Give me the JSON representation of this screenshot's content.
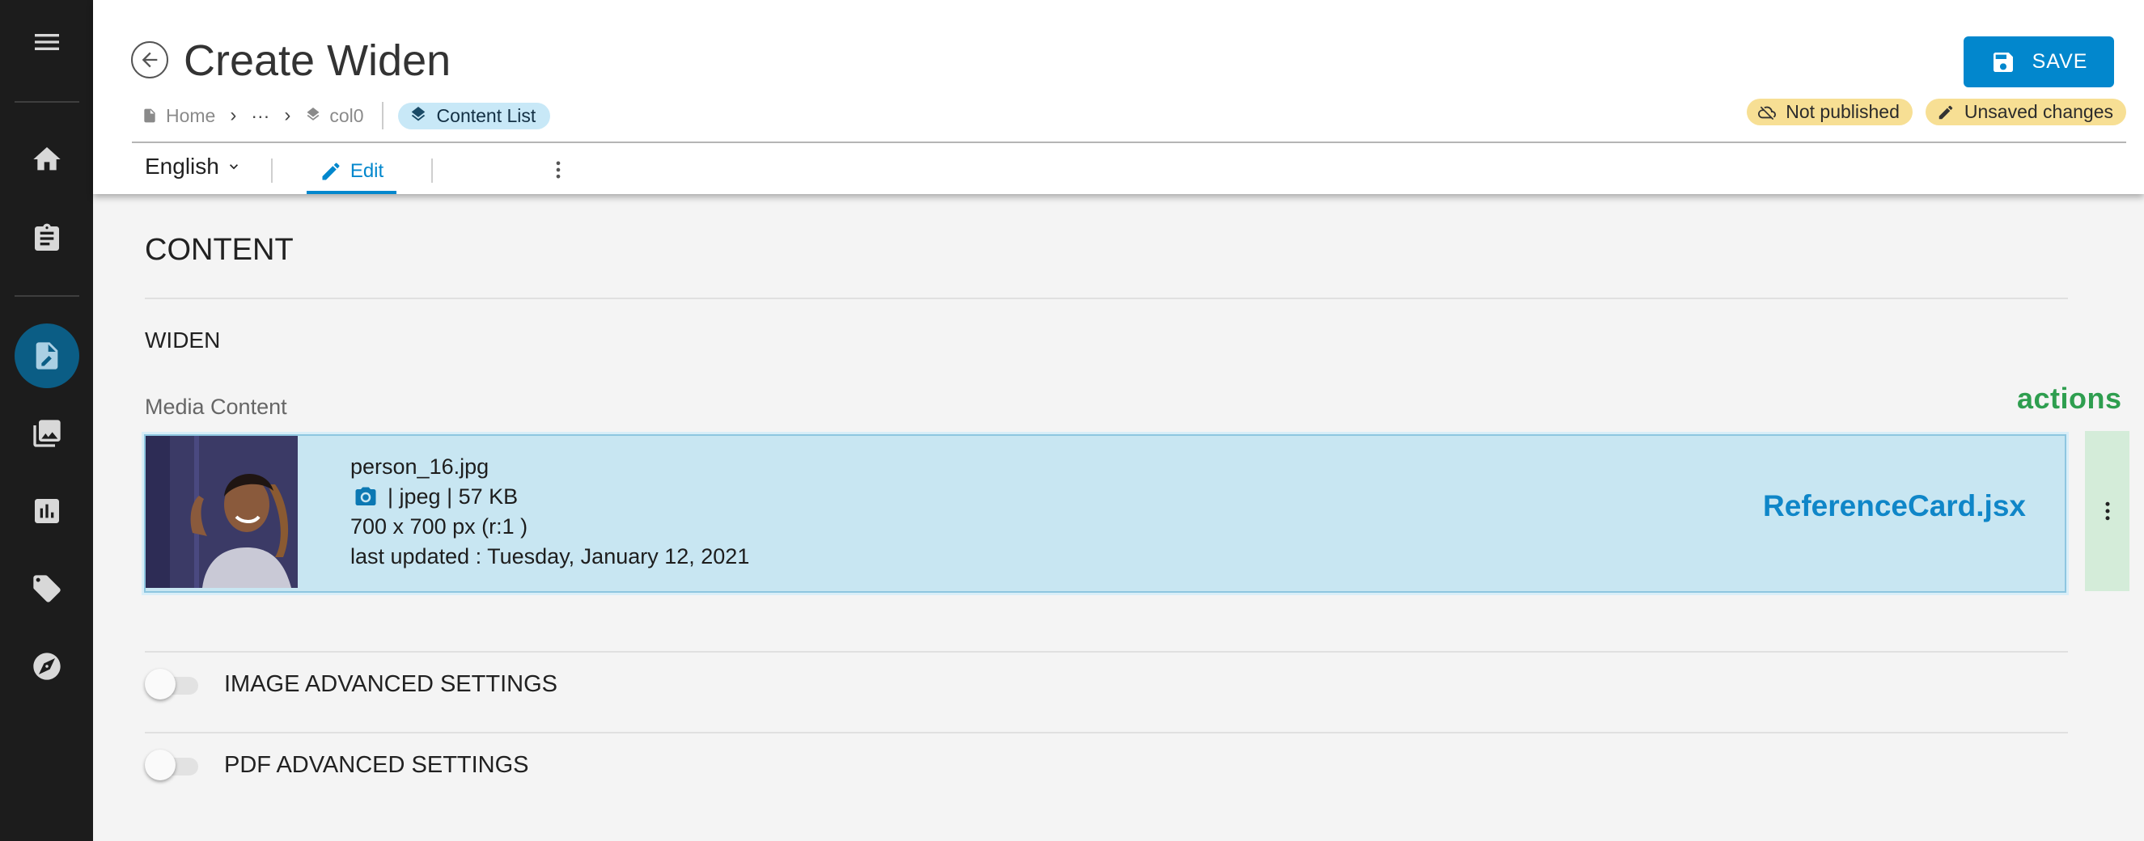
{
  "header": {
    "title": "Create Widen",
    "save_label": "SAVE",
    "breadcrumb": {
      "home": "Home",
      "ellipsis": "···",
      "collection": "col0",
      "current": "Content List"
    },
    "status": {
      "published": "Not published",
      "changes": "Unsaved changes"
    }
  },
  "toolbar": {
    "language": "English",
    "edit_label": "Edit"
  },
  "sidebar": {
    "icons": [
      "menu-icon",
      "home-icon",
      "clipboard-icon",
      "content-edit-icon",
      "images-icon",
      "analytics-icon",
      "tag-icon",
      "compass-icon"
    ],
    "active": "content-edit-icon"
  },
  "content": {
    "title": "CONTENT",
    "section": "WIDEN",
    "media_label": "Media Content",
    "actions_label": "actions",
    "card": {
      "filename": "person_16.jpg",
      "type_info": "| jpeg | 57 KB",
      "dimensions": "700 x 700 px (r:1 )",
      "updated": "last updated : Tuesday, January 12, 2021",
      "component_label": "ReferenceCard.jsx"
    },
    "settings": [
      {
        "label": "IMAGE ADVANCED SETTINGS",
        "enabled": false
      },
      {
        "label": "PDF ADVANCED SETTINGS",
        "enabled": false
      }
    ]
  },
  "colors": {
    "accent": "#0287cd",
    "sidebar": "#1c1c1c",
    "card_bg": "#c8e6f2",
    "actions_green": "#2e9e4f",
    "warning_chip": "#f7df94"
  }
}
